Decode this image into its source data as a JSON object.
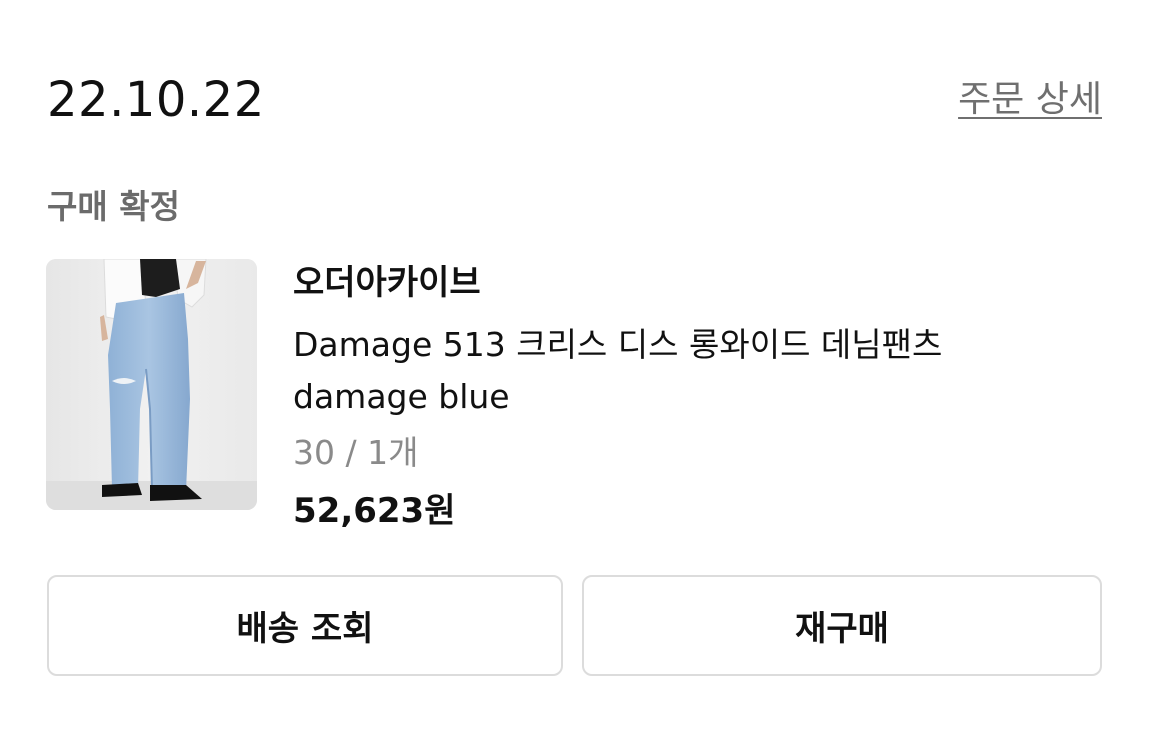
{
  "order": {
    "date": "22.10.22",
    "detail_link": "주문 상세",
    "status": "구매 확정"
  },
  "product": {
    "brand": "오더아카이브",
    "name_line1": "Damage 513 크리스 디스 롱와이드 데님팬츠",
    "name_line2": "damage blue",
    "option": "30 / 1개",
    "price": "52,623원",
    "image_icon": "jeans-product-photo"
  },
  "actions": {
    "track_delivery": "배송 조회",
    "reorder": "재구매"
  }
}
